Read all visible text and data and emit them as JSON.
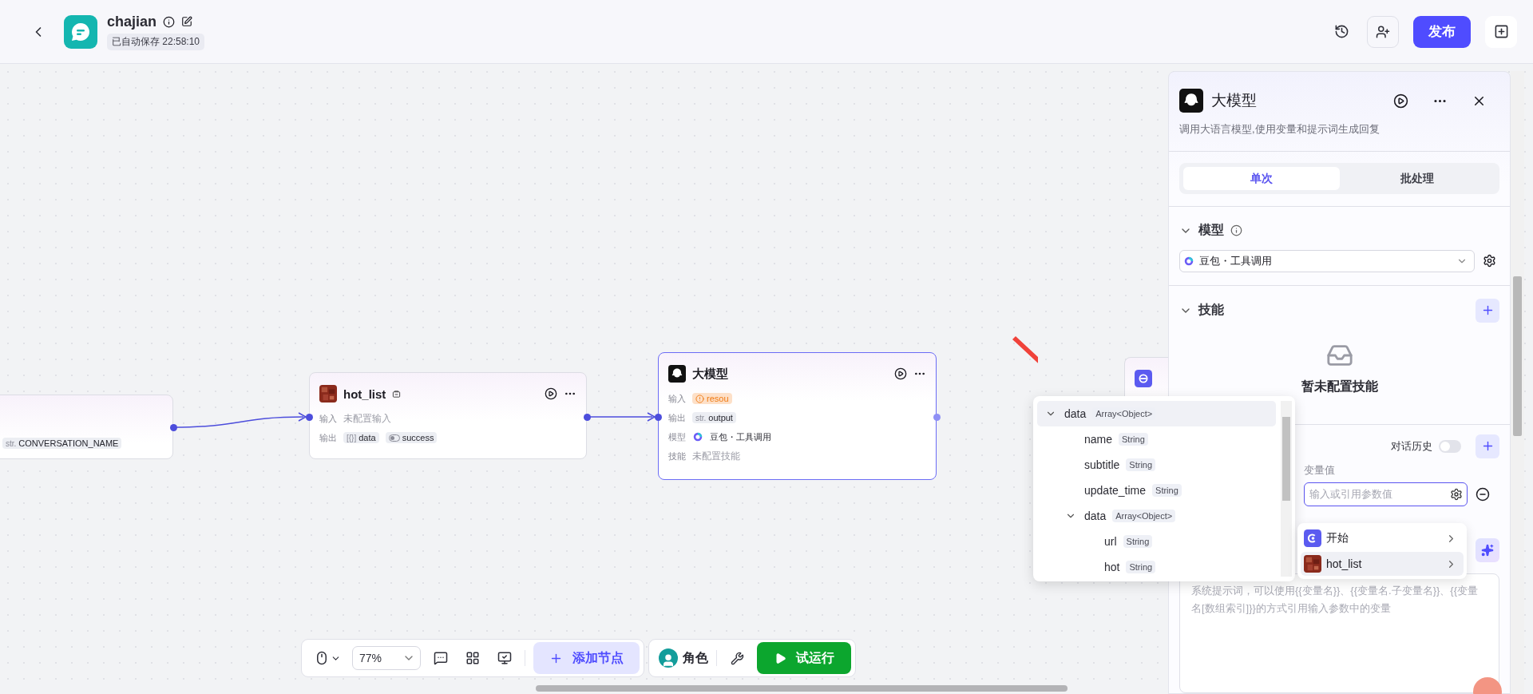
{
  "header": {
    "title": "chajian",
    "autosave": "已自动保存 22:58:10",
    "publish": "发布"
  },
  "canvas": {
    "nodes": [
      {
        "kind": "partial",
        "selected": false,
        "rows": [
          {
            "kind": "chips",
            "chips": [
              {
                "kind": "string",
                "prefix": "str.",
                "label": "CONVERSATION_NAME"
              }
            ]
          }
        ]
      },
      {
        "kind": "plugin",
        "title": "hot_list",
        "selected": false,
        "rows": [
          {
            "kind": "text",
            "label": "输入",
            "text": "未配置输入"
          },
          {
            "kind": "chips",
            "label": "输出",
            "chips": [
              {
                "kind": "array",
                "prefix": "[{}]",
                "label": "data"
              },
              {
                "kind": "boolean",
                "label": "success"
              }
            ]
          }
        ]
      },
      {
        "kind": "llm",
        "title": "大模型",
        "selected": true,
        "rows": [
          {
            "kind": "chips",
            "label": "输入",
            "chips": [
              {
                "kind": "warning",
                "label": "resou"
              }
            ]
          },
          {
            "kind": "chips",
            "label": "输出",
            "chips": [
              {
                "kind": "string",
                "prefix": "str.",
                "label": "output"
              }
            ]
          },
          {
            "kind": "model",
            "label": "模型",
            "text": "豆包・工具调用"
          },
          {
            "kind": "text",
            "label": "技能",
            "text": "未配置技能"
          }
        ]
      },
      {
        "kind": "stub",
        "selected": false
      }
    ]
  },
  "toolbar": {
    "zoom": "77%",
    "add_node": "添加节点",
    "role": "角色",
    "test_run": "试运行"
  },
  "panel": {
    "title": "大模型",
    "description": "调用大语言模型,使用变量和提示词生成回复",
    "tabs": [
      {
        "label": "单次",
        "selected": true
      },
      {
        "label": "批处理",
        "selected": false
      }
    ],
    "model": {
      "heading": "模型",
      "expanded": true,
      "value": "豆包・工具调用"
    },
    "skills": {
      "heading": "技能",
      "expanded": true,
      "empty": "暂未配置技能"
    },
    "inputs": {
      "history_label": "对话历史",
      "history_on": false,
      "value_column": "变量值",
      "placeholder": "输入或引用参数值"
    },
    "prompt": {
      "placeholder": "系统提示词，可以使用{{变量名}}、{{变量名.子变量名}}、{{变量名[数组索引]}}的方式引用输入参数中的变量"
    }
  },
  "variable_menu": {
    "items": [
      {
        "label": "开始",
        "kind": "start",
        "selected": false
      },
      {
        "label": "hot_list",
        "kind": "plugin",
        "selected": true
      }
    ]
  },
  "tree": {
    "items": [
      {
        "name": "data",
        "type": "Array<Object>",
        "expanded": true,
        "selected": true,
        "children": [
          {
            "name": "name",
            "type": "String",
            "selected": false
          },
          {
            "name": "subtitle",
            "type": "String",
            "selected": false
          },
          {
            "name": "update_time",
            "type": "String",
            "selected": false
          },
          {
            "name": "data",
            "type": "Array<Object>",
            "expanded": true,
            "selected": false,
            "children": [
              {
                "name": "url",
                "type": "String",
                "selected": false
              },
              {
                "name": "hot",
                "type": "String",
                "selected": false
              }
            ]
          }
        ]
      }
    ]
  }
}
